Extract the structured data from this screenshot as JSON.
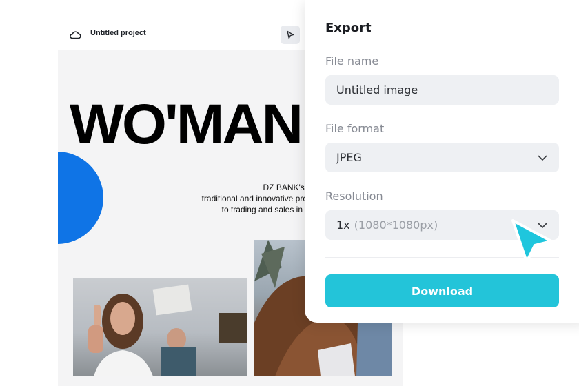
{
  "editor": {
    "project_title": "Untitled project",
    "headline": "WO'MAN",
    "body_lines": [
      "DZ BANK's range of s",
      "traditional and innovative products, s",
      "to trading and sales in the equ"
    ]
  },
  "export_panel": {
    "title": "Export",
    "file_name": {
      "label": "File name",
      "value": "Untitled image"
    },
    "file_format": {
      "label": "File format",
      "value": "JPEG"
    },
    "resolution": {
      "label": "Resolution",
      "value": "1x",
      "detail": "(1080*1080px)"
    },
    "download_label": "Download"
  },
  "colors": {
    "accent": "#23c4d9",
    "cursor": "#1fc6dd",
    "circle": "#0f74e6"
  },
  "icons": [
    "cloud-icon",
    "cursor-arrow-icon",
    "chevron-down-icon",
    "pointer-cursor-icon"
  ]
}
